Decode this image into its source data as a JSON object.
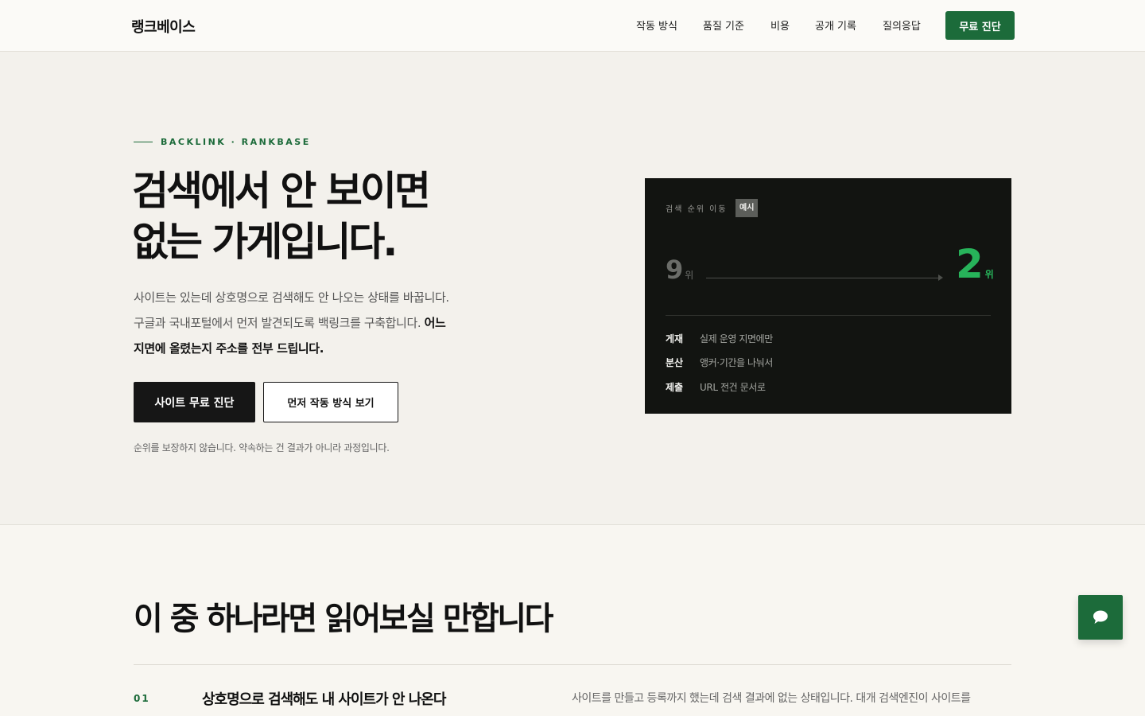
{
  "header": {
    "logo": "랭크베이스",
    "nav": [
      "작동 방식",
      "품질 기준",
      "비용",
      "공개 기록",
      "질의응답"
    ],
    "cta": "무료 진단"
  },
  "hero": {
    "eyebrow": "BACKLINK · RANKBASE",
    "title": [
      "검색에서 안 보이면",
      "없는 가게입니다."
    ],
    "desc_line1": "사이트는 있는데 상호명으로 검색해도 안 나오는 상태를 바꿉니다.",
    "desc_line2_plain": "구글과 국내포털에서 먼저 발견되도록 백링크를 구축합니다.",
    "desc_line2_bold": "어느",
    "desc_line3_bold": "지면에 올렸는지 주소를 전부 드립니다.",
    "primary_button": "사이트 무료 진단",
    "secondary_button": "먼저 작동 방식 보기",
    "note": "순위를 보장하지 않습니다. 약속하는 건 결과가 아니라 과정입니다."
  },
  "card": {
    "label": "검색 순위 이동",
    "badge": "예시",
    "rank_from": "9",
    "rank_to": "2",
    "rank_unit": "위",
    "rows": [
      {
        "key": "게재",
        "value": "실제 운영 지면에만"
      },
      {
        "key": "분산",
        "value": "앵커·기간을 나눠서"
      },
      {
        "key": "제출",
        "value": "URL 전건 문서로"
      }
    ]
  },
  "section": {
    "title": "이 중 하나라면 읽어보실 만합니다",
    "items": [
      {
        "num": "01",
        "title": "상호명으로 검색해도 내 사이트가 안 나온다",
        "desc": "사이트를 만들고 등록까지 했는데 검색 결과에 없는 상태입니다. 대개 검색엔진이 사이트를"
      }
    ]
  },
  "chat": {
    "icon": "chat-bubble-icon"
  },
  "colors": {
    "accent": "#1c6b3a",
    "rank_green": "#27b35a",
    "card_bg": "#121411"
  }
}
